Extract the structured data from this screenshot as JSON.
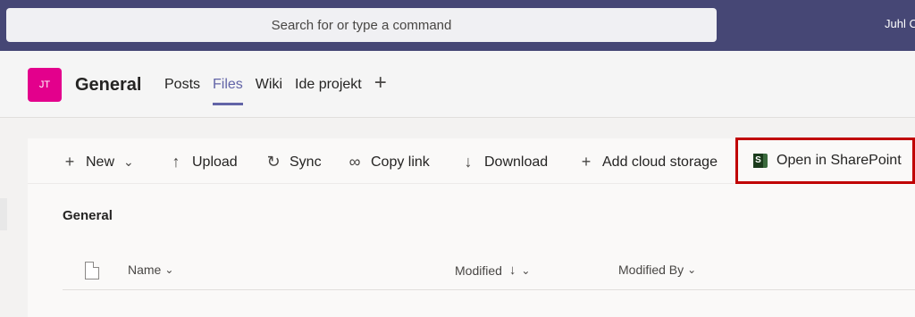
{
  "topbar": {
    "search_placeholder": "Search for or type a command",
    "user_name": "Juhl C"
  },
  "channel": {
    "avatar_initials": "JT",
    "title": "General",
    "tabs": [
      {
        "label": "Posts"
      },
      {
        "label": "Files"
      },
      {
        "label": "Wiki"
      },
      {
        "label": "Ide projekt"
      }
    ],
    "add_tab_icon": "plus-icon"
  },
  "toolbar": {
    "new_label": "New",
    "upload_label": "Upload",
    "sync_label": "Sync",
    "copy_link_label": "Copy link",
    "download_label": "Download",
    "add_cloud_label": "Add cloud storage",
    "open_sharepoint_label": "Open in SharePoint"
  },
  "files": {
    "folder_title": "General",
    "columns": {
      "name": "Name",
      "modified": "Modified",
      "modified_by": "Modified By"
    }
  },
  "colors": {
    "topbar": "#464775",
    "accent": "#6264a7",
    "avatar": "#e3008c",
    "highlight": "#c00000"
  }
}
